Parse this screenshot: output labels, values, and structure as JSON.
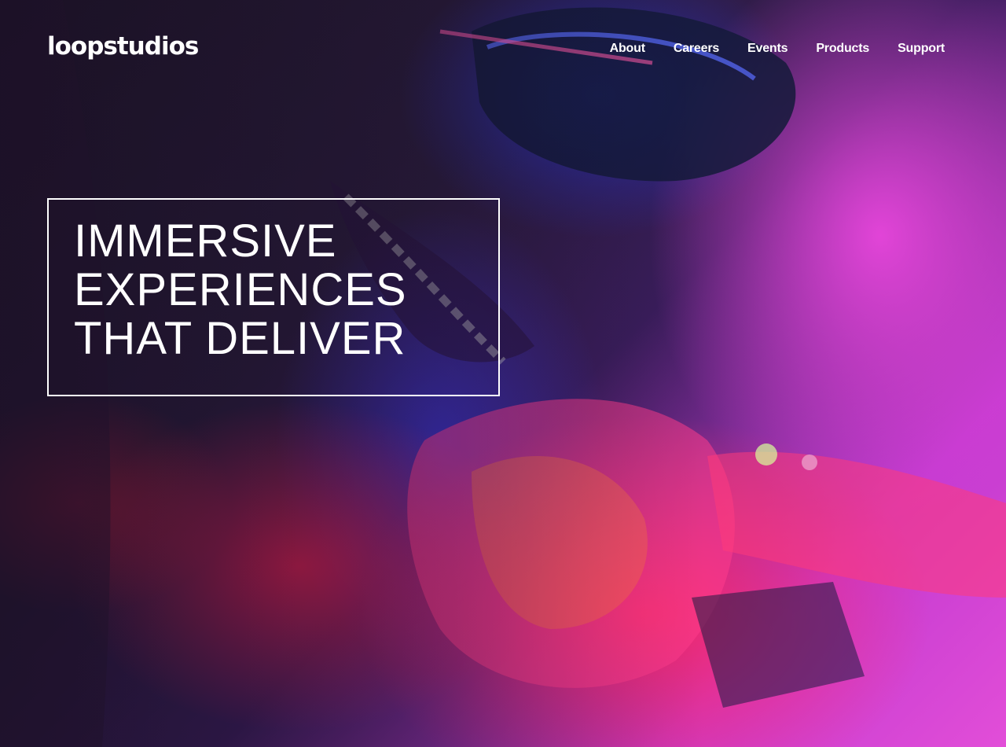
{
  "header": {
    "logo": "loopstudios",
    "nav": [
      "About",
      "Careers",
      "Events",
      "Products",
      "Support"
    ]
  },
  "hero": {
    "image": "vr-headset-photo",
    "headline": "Immersive experiences that deliver"
  },
  "colors": {
    "text": "#ffffff",
    "magenta": "#e24ed8",
    "pink_red": "#ff2864",
    "blue": "#3232c8",
    "dark": "#23182e"
  }
}
